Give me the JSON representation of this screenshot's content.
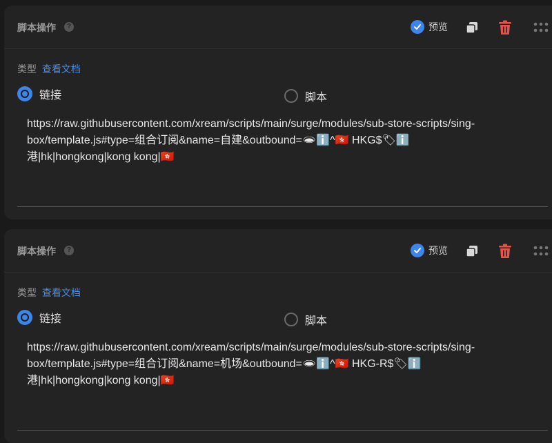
{
  "cards": [
    {
      "title": "脚本操作",
      "help_icon": "?",
      "preview_label": "预览",
      "type_label": "类型",
      "doc_link": "查看文档",
      "radio_link": "链接",
      "radio_script": "脚本",
      "selected": "link",
      "url_line1": "https://raw.githubusercontent.com/xream/scripts/main/surge/modules/sub-store-scripts/sing-",
      "url_line2": "box/template.js#type=组合订阅&name=自建&outbound=🕳ℹ️^🇭🇰 HKG$🏷ℹ️",
      "url_line3": "港|hk|hongkong|kong kong|🇭🇰"
    },
    {
      "title": "脚本操作",
      "help_icon": "?",
      "preview_label": "预览",
      "type_label": "类型",
      "doc_link": "查看文档",
      "radio_link": "链接",
      "radio_script": "脚本",
      "selected": "link",
      "url_line1": "https://raw.githubusercontent.com/xream/scripts/main/surge/modules/sub-store-scripts/sing-",
      "url_line2": "box/template.js#type=组合订阅&name=机场&outbound=🕳ℹ️^🇭🇰 HKG-R$🏷ℹ️",
      "url_line3": "港|hk|hongkong|kong kong|🇭🇰"
    }
  ],
  "colors": {
    "accent": "#3d85e8",
    "link": "#4a8de6",
    "delete": "#e5534b",
    "card_bg": "#232323"
  },
  "icons": [
    "help-icon",
    "check-icon",
    "copy-icon",
    "trash-icon",
    "drag-handle-icon"
  ]
}
